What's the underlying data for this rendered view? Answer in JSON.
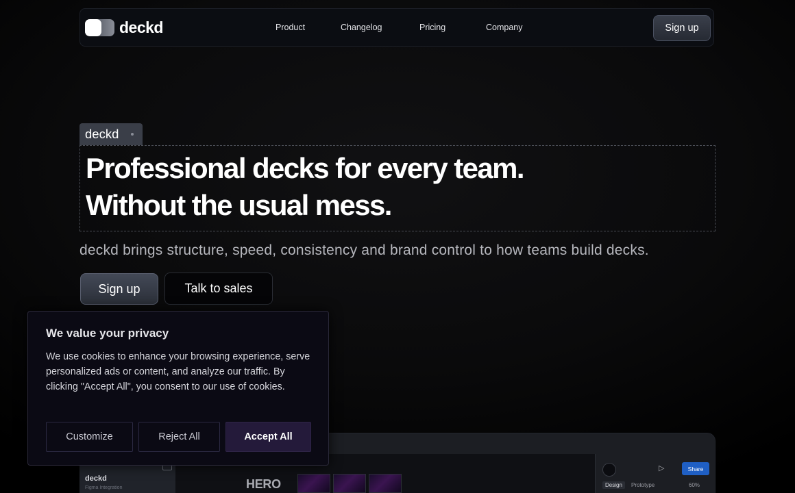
{
  "nav": {
    "brand": "deckd",
    "links": [
      "Product",
      "Changelog",
      "Pricing",
      "Company"
    ],
    "signup_label": "Sign up"
  },
  "hero": {
    "tag": "deckd",
    "headline_line1": "Professional decks for every team.",
    "headline_line2": "Without the usual mess.",
    "subhead": "deckd brings structure, speed, consistency and brand control to how teams build decks.",
    "primary_cta": "Sign up",
    "secondary_cta": "Talk to sales"
  },
  "preview": {
    "project_name": "deckd",
    "project_sub": "Figma Integration",
    "canvas_label": "HERO",
    "share_label": "Share",
    "tab_design": "Design",
    "tab_prototype": "Prototype",
    "zoom": "60%"
  },
  "cookie": {
    "title": "We value your privacy",
    "body": "We use cookies to enhance your browsing experience, serve personalized ads or content, and analyze our traffic. By clicking \"Accept All\", you consent to our use of cookies.",
    "customize_label": "Customize",
    "reject_label": "Reject All",
    "accept_label": "Accept All"
  },
  "colors": {
    "background": "#000000",
    "nav_bg": "#0b0d12",
    "button_gray": "#3a3f4b",
    "cookie_bg": "#0b0a14",
    "accept_bg": "#241a3a",
    "share_blue": "#1f5fc4"
  }
}
